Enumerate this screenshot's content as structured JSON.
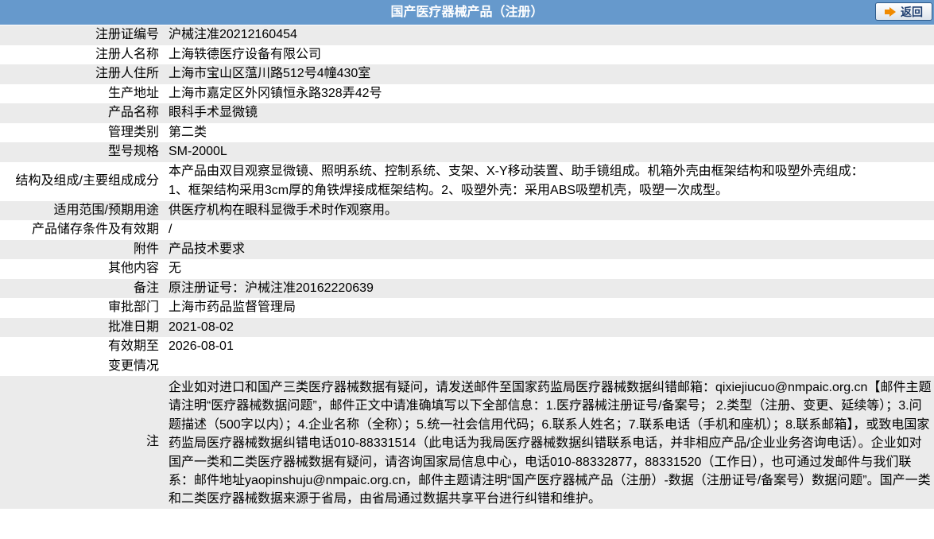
{
  "header": {
    "title": "国产医疗器械产品（注册）",
    "back_label": "返回"
  },
  "rows": [
    {
      "label": "注册证编号",
      "value": "沪械注准20212160454"
    },
    {
      "label": "注册人名称",
      "value": "上海轶德医疗设备有限公司"
    },
    {
      "label": "注册人住所",
      "value": "上海市宝山区蕰川路512号4幢430室"
    },
    {
      "label": "生产地址",
      "value": "上海市嘉定区外冈镇恒永路328弄42号"
    },
    {
      "label": "产品名称",
      "value": "眼科手术显微镜"
    },
    {
      "label": "管理类别",
      "value": "第二类"
    },
    {
      "label": "型号规格",
      "value": "SM-2000L"
    },
    {
      "label": "结构及组成/主要组成成分",
      "value": "本产品由双目观察显微镜、照明系统、控制系统、支架、X-Y移动装置、助手镜组成。机箱外壳由框架结构和吸塑外壳组成：",
      "value2": "1、框架结构采用3cm厚的角铁焊接成框架结构。2、吸塑外壳：采用ABS吸塑机壳，吸塑一次成型。"
    },
    {
      "label": "适用范围/预期用途",
      "value": "供医疗机构在眼科显微手术时作观察用。"
    },
    {
      "label": "产品储存条件及有效期",
      "value": "/"
    },
    {
      "label": "附件",
      "value": "产品技术要求"
    },
    {
      "label": "其他内容",
      "value": "无"
    },
    {
      "label": "备注",
      "value": "原注册证号：沪械注准20162220639"
    },
    {
      "label": "审批部门",
      "value": "上海市药品监督管理局"
    },
    {
      "label": "批准日期",
      "value": "2021-08-02"
    },
    {
      "label": "有效期至",
      "value": "2026-08-01"
    },
    {
      "label": "变更情况",
      "value": ""
    }
  ],
  "note": {
    "label": "注",
    "text": "企业如对进口和国产三类医疗器械数据有疑问，请发送邮件至国家药监局医疗器械数据纠错邮箱：qixiejiucuo@nmpaic.org.cn【邮件主题请注明“医疗器械数据问题”，邮件正文中请准确填写以下全部信息：1.医疗器械注册证号/备案号； 2.类型（注册、变更、延续等）；3.问题描述（500字以内）；4.企业名称（全称）；5.统一社会信用代码；6.联系人姓名；7.联系电话（手机和座机）；8.联系邮箱】，或致电国家药监局医疗器械数据纠错电话010-88331514（此电话为我局医疗器械数据纠错联系电话，并非相应产品/企业业务咨询电话）。企业如对国产一类和二类医疗器械数据有疑问，请咨询国家局信息中心，电话010-88332877，88331520（工作日），也可通过发邮件与我们联系：邮件地址yaopinshuju@nmpaic.org.cn，邮件主题请注明“国产医疗器械产品（注册）-数据（注册证号/备案号）数据问题”。国产一类和二类医疗器械数据来源于省局，由省局通过数据共享平台进行纠错和维护。"
  }
}
